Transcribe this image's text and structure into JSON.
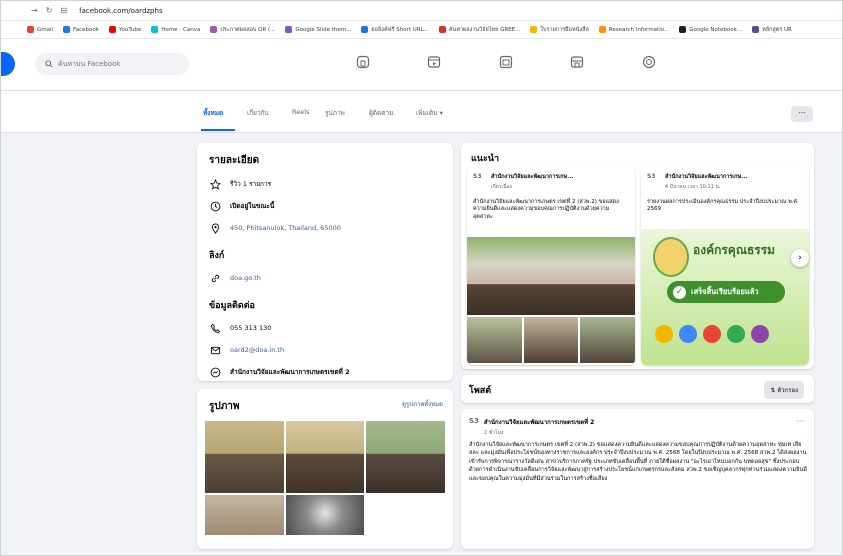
{
  "browser": {
    "url": "facebook.com/oardzphs",
    "bookmarks": [
      {
        "label": "Gmail",
        "color": "#ea4335"
      },
      {
        "label": "Facebook",
        "color": "#1877f2"
      },
      {
        "label": "YouTube",
        "color": "#ff0000"
      },
      {
        "label": "Home - Canva",
        "color": "#00c4cc"
      },
      {
        "label": "ประกาศผลสอบ QR (...",
        "color": "#9b59b6"
      },
      {
        "label": "Google Slide them...",
        "color": "#7e57c2"
      },
      {
        "label": "ย่อลิงค์ฟรี Short URL...",
        "color": "#1a73e8"
      },
      {
        "label": "ค้นหาผลงานวิจัยไทย GREE...",
        "color": "#d93025"
      },
      {
        "label": "ใบรายการยืมหนังสือ",
        "color": "#f4b400"
      },
      {
        "label": "Research Informatio...",
        "color": "#ff8f00"
      },
      {
        "label": "Google Notebook...",
        "color": "#202124"
      },
      {
        "label": "หลักสูตร UR",
        "color": "#5f4b8b"
      }
    ]
  },
  "header": {
    "search_placeholder": "ค้นหาบน Facebook"
  },
  "tabs": [
    "ทั้งหมด",
    "เกี่ยวกับ",
    "Reels",
    "รูปภาพ",
    "ผู้ติดตาม",
    "เพิ่มเติม ▾"
  ],
  "more_button": "···",
  "details": {
    "title": "รายละเอียด",
    "rating": "รีวิว 1 รายการ",
    "open_status": "เปิดอยู่ในขณะนี้",
    "address": "450, Phitsanulok, Thailand, 65000",
    "links_title": "ลิงก์",
    "website": "doa.go.th",
    "contact_title": "ข้อมูลติดต่อ",
    "phone": "055 313 130",
    "email": "oard2@doa.in.th",
    "messenger": "สำนักงานวิจัยและพัฒนาการเกษตรเขตที่ 2"
  },
  "photos_card": {
    "title": "รูปภาพ",
    "see_all": "ดูรูปภาพทั้งหมด"
  },
  "recommended": {
    "title": "แนะนำ",
    "posts": [
      {
        "name": "สำนักงานวิจัยและพัฒนาการเกษ...",
        "meta": "เกี่ยวเนื่อง",
        "body": "สำนักงานวิจัยและพัฒนาการเกษตร เขตที่ 2 (สวพ.2) ขอแสดงความยินดีและแสดงความขอบคุณการปฏิบัติงานด้วยความอุตสาหะ"
      },
      {
        "name": "สำนักงานวิจัยและพัฒนาการเกษ...",
        "meta": "4 มีนาคม เวลา 10:11 น.",
        "body": "รายงานผลการประเมินองค์กรคุณธรรม ประจำปีงบประมาณ พ.ศ. 2569",
        "banner_title": "องค์กรคุณธรรม",
        "banner_subtitle": "เสร็จสิ้นเรียบร้อยแล้ว"
      }
    ]
  },
  "posts_section": {
    "title": "โพสต์",
    "filter": "ตัวกรอง",
    "post": {
      "name": "สำนักงานวิจัยและพัฒนาการเกษตรเขตที่ 2",
      "meta": "2 ชั่วโมง",
      "body": "สำนักงานวิจัยและพัฒนาการเกษตร เขตที่ 2 (สวพ.2) ขอแสดงความยินดีและแสดงความขอบคุณการปฏิบัติงานด้วยความอุตสาหะ ทุ่มเท เสียสละ และมุ่งมั่นเพื่อประโยชน์ของทางราชการและองค์กร ประจำปีงบประมาณ พ.ศ. 2568 โดยในปีงบประมาณ พ.ศ. 2568 สวพ.2 ได้ส่งผลงานเข้ารับการพิจารณารางวัลดีเด่น สาขาบริการภาครัฐ ประเภทขับเคลื่อนพื้นที่ ภายใต้ชื่อผลงาน \"อะไรเอาไหนบอกกัน บทดอยสุข\" ซึ่งประกอบด้วยการดำเนินงานขับเคลื่อนการวิจัยและพัฒนาสู่การสร้างประโยชน์แก่เกษตรกรและสังคม สวพ.2 ขอเชิญบุคลากรทุกท่านร่วมแสดงความยินดี และขอบคุณในความมุ่งมั่นที่มีส่วนร่วมในการสร้างชื่อเสียง"
    }
  }
}
